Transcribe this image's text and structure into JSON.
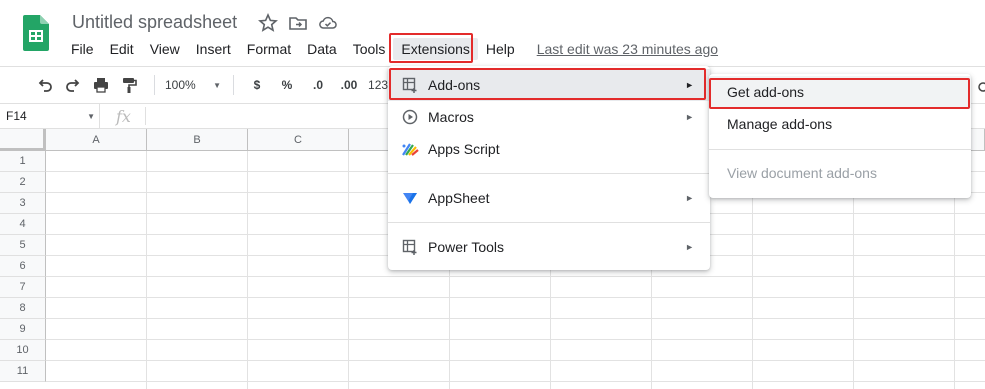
{
  "app": {
    "doc_title": "Untitled spreadsheet",
    "icons": [
      "sheets-logo-icon",
      "star-icon",
      "move-folder-icon",
      "cloud-saved-icon"
    ]
  },
  "menubar": {
    "items": [
      "File",
      "Edit",
      "View",
      "Insert",
      "Format",
      "Data",
      "Tools",
      "Extensions",
      "Help"
    ],
    "active": "Extensions",
    "last_edit": "Last edit was 23 minutes ago"
  },
  "toolbar": {
    "zoom": "100%",
    "currency": "$",
    "percent": "%",
    "decrease_decimal": ".0",
    "increase_decimal": ".00",
    "more_formats": "123"
  },
  "formula_bar": {
    "cell_ref": "F14",
    "fx": "fx"
  },
  "grid": {
    "columns": [
      "A",
      "B",
      "C"
    ],
    "rows": [
      "1",
      "2",
      "3",
      "4",
      "5",
      "6",
      "7",
      "8",
      "9",
      "10",
      "11"
    ]
  },
  "extensions_menu": {
    "items": [
      {
        "label": "Add-ons",
        "icon": "addons-icon",
        "has_submenu": true,
        "highlighted": true
      },
      {
        "label": "Macros",
        "icon": "play-circle-icon",
        "has_submenu": true
      },
      {
        "label": "Apps Script",
        "icon": "apps-script-icon",
        "has_submenu": false
      },
      {
        "label": "AppSheet",
        "icon": "appsheet-icon",
        "has_submenu": true
      },
      {
        "label": "Power Tools",
        "icon": "power-tools-icon",
        "has_submenu": true
      }
    ]
  },
  "addons_submenu": {
    "items": [
      {
        "label": "Get add-ons",
        "highlighted": true
      },
      {
        "label": "Manage add-ons"
      },
      {
        "label": "View document add-ons",
        "disabled": true
      }
    ]
  },
  "colors": {
    "highlight_border": "#e32b2b",
    "sheets_green": "#23a566",
    "menu_text": "#202124",
    "muted_text": "#5f6368"
  }
}
